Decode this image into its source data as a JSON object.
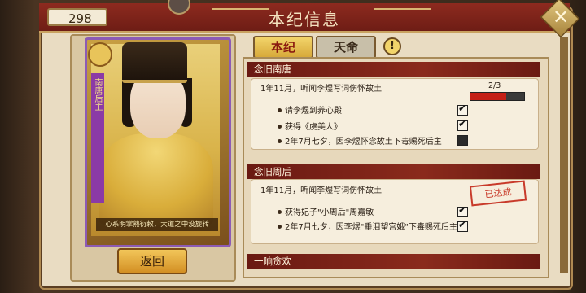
{
  "header": {
    "title": "本纪信息",
    "counter": "298"
  },
  "tabs": [
    {
      "label": "本纪"
    },
    {
      "label": "天命"
    }
  ],
  "card": {
    "side_text": "南唐后主",
    "caption": "心系明掌熟衍敕，大道之中没旋转",
    "badge": "圣"
  },
  "back_button": "返回",
  "warning": "!",
  "sections": [
    {
      "title": "念旧南唐",
      "desc": "1年11月，听闻李煜写词伤怀故土",
      "progress_text": "2/3",
      "progress": 0.67,
      "items": [
        {
          "text": "请李煜到养心殿",
          "checked": true
        },
        {
          "text": "获得《虞美人》",
          "checked": true
        },
        {
          "text": "2年7月七夕，因李煜怀念故土下毒赐死后主",
          "checked": false
        }
      ]
    },
    {
      "title": "念旧周后",
      "desc": "1年11月，听闻李煜写词伤怀故土",
      "stamp": "已达成",
      "items": [
        {
          "text": "获得妃子\"小周后\"周嘉敏",
          "checked": true
        },
        {
          "text": "2年7月七夕，因李煜\"垂泪望宫娥\"下毒赐死后主",
          "checked": true
        }
      ]
    },
    {
      "title": "一晌贪欢"
    }
  ]
}
